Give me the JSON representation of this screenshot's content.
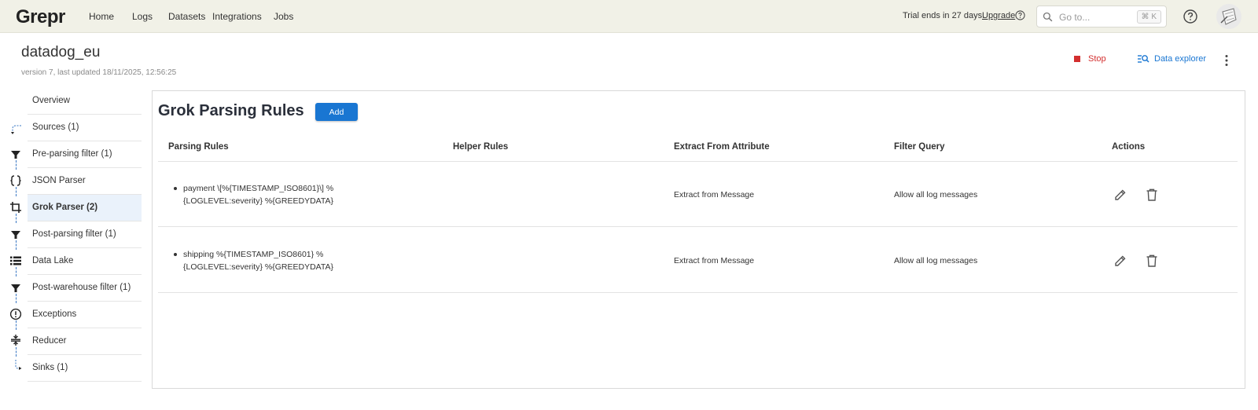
{
  "topbar": {
    "logo": "Grepr",
    "nav": [
      "Home",
      "Logs",
      "Datasets",
      "Integrations",
      "Jobs"
    ],
    "trial_text": "Trial ends in 27 days.",
    "upgrade_label": "Upgrade",
    "search_placeholder": "Go to...",
    "search_shortcut": "⌘ K"
  },
  "header": {
    "title": "datadog_eu",
    "subtitle": "version 7, last updated 18/11/2025, 12:56:25",
    "stop_label": "Stop",
    "explorer_label": "Data explorer"
  },
  "sidebar": {
    "items": [
      {
        "label": "Overview",
        "icon": "none"
      },
      {
        "label": "Sources (1)",
        "icon": "source-arrow-icon"
      },
      {
        "label": "Pre-parsing filter (1)",
        "icon": "filter-icon"
      },
      {
        "label": "JSON Parser",
        "icon": "braces-icon"
      },
      {
        "label": "Grok Parser (2)",
        "icon": "crop-icon",
        "active": true
      },
      {
        "label": "Post-parsing filter (1)",
        "icon": "filter-icon"
      },
      {
        "label": "Data Lake",
        "icon": "list-icon"
      },
      {
        "label": "Post-warehouse filter (1)",
        "icon": "filter-icon"
      },
      {
        "label": "Exceptions",
        "icon": "alert-circle-icon"
      },
      {
        "label": "Reducer",
        "icon": "compress-icon"
      },
      {
        "label": "Sinks (1)",
        "icon": "sink-arrow-icon"
      }
    ]
  },
  "main": {
    "title": "Grok Parsing Rules",
    "add_label": "Add",
    "columns": [
      "Parsing Rules",
      "Helper Rules",
      "Extract From Attribute",
      "Filter Query",
      "Actions"
    ],
    "rows": [
      {
        "rule_line1": "payment \\[%{TIMESTAMP_ISO8601}\\] %",
        "rule_line2": "{LOGLEVEL:severity} %{GREEDYDATA}",
        "helper": "",
        "extract": "Extract from Message",
        "filter": "Allow all log messages"
      },
      {
        "rule_line1": "shipping %{TIMESTAMP_ISO8601} %",
        "rule_line2": "{LOGLEVEL:severity} %{GREEDYDATA}",
        "helper": "",
        "extract": "Extract from Message",
        "filter": "Allow all log messages"
      }
    ]
  },
  "colors": {
    "accent": "#1976d2",
    "stop": "#d32f2f",
    "topbar_bg": "#f1f1e7",
    "active_bg": "#eaf2fb"
  }
}
